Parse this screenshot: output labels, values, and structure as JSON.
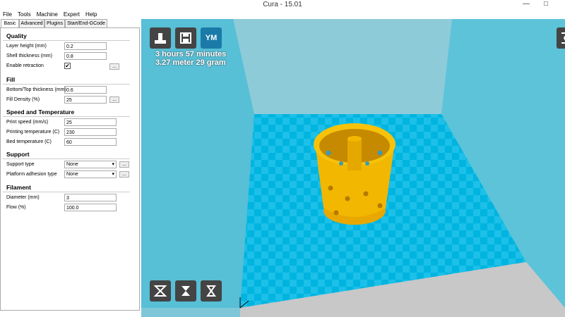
{
  "window": {
    "title": "Cura - 15.01",
    "minimize": "—",
    "maximize": "□"
  },
  "menu": {
    "items": [
      "File",
      "Tools",
      "Machine",
      "Expert",
      "Help"
    ]
  },
  "tabs": [
    "Basic",
    "Advanced",
    "Plugins",
    "Start/End-GCode"
  ],
  "sections": {
    "quality": "Quality",
    "fill": "Fill",
    "speed": "Speed and Temperature",
    "support": "Support",
    "filament": "Filament"
  },
  "fields": {
    "layer_height": {
      "label": "Layer height (mm)",
      "value": "0.2"
    },
    "shell_thickness": {
      "label": "Shell thickness (mm)",
      "value": "0.8"
    },
    "enable_retraction": {
      "label": "Enable retraction",
      "checked": "✔"
    },
    "bottom_top": {
      "label": "Bottom/Top thickness (mm)",
      "value": "0.6"
    },
    "fill_density": {
      "label": "Fill Density (%)",
      "value": "25"
    },
    "print_speed": {
      "label": "Print speed (mm/s)",
      "value": "25"
    },
    "print_temp": {
      "label": "Printing temperature (C)",
      "value": "230"
    },
    "bed_temp": {
      "label": "Bed temperature (C)",
      "value": "60"
    },
    "support_type": {
      "label": "Support type",
      "value": "None"
    },
    "adhesion": {
      "label": "Platform adhesion type",
      "value": "None"
    },
    "diameter": {
      "label": "Diameter (mm)",
      "value": "3"
    },
    "flow": {
      "label": "Flow (%)",
      "value": "100.0"
    }
  },
  "more_label": "...",
  "viewport": {
    "time": "3 hours 57 minutes",
    "material": "3.27 meter 29 gram",
    "ym_label": "YM"
  },
  "colors": {
    "bed": "#00b4e0",
    "model": "#f2b700",
    "wall": "#7fc7d8"
  }
}
